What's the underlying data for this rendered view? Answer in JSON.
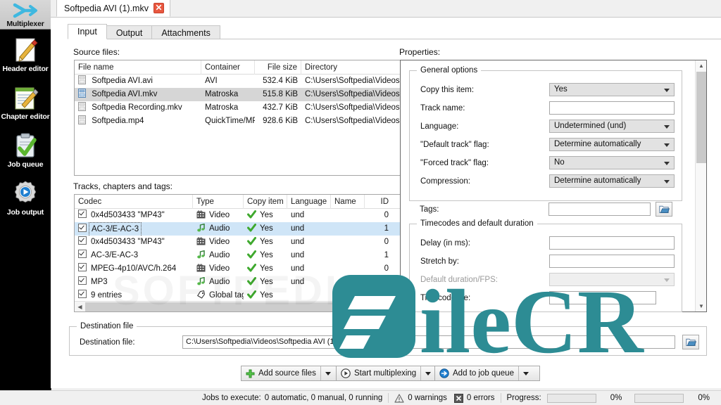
{
  "sidebar": {
    "items": [
      {
        "label": "Multiplexer",
        "icon": "multiplexer-icon",
        "active": true
      },
      {
        "label": "Header editor",
        "icon": "header-editor-icon",
        "active": false
      },
      {
        "label": "Chapter editor",
        "icon": "chapter-editor-icon",
        "active": false
      },
      {
        "label": "Job queue",
        "icon": "job-queue-icon",
        "active": false
      },
      {
        "label": "Job output",
        "icon": "job-output-icon",
        "active": false
      }
    ]
  },
  "document_tab": {
    "title": "Softpedia AVI (1).mkv",
    "close_label": "×"
  },
  "tabs": [
    {
      "label": "Input",
      "active": true
    },
    {
      "label": "Output",
      "active": false
    },
    {
      "label": "Attachments",
      "active": false
    }
  ],
  "source_files": {
    "label": "Source files:",
    "columns": [
      "File name",
      "Container",
      "File size",
      "Directory"
    ],
    "rows": [
      {
        "name": "Softpedia AVI.avi",
        "container": "AVI",
        "size": "532.4 KiB",
        "dir": "C:\\Users\\Softpedia\\Videos",
        "selected": false
      },
      {
        "name": "Softpedia AVI.mkv",
        "container": "Matroska",
        "size": "515.8 KiB",
        "dir": "C:\\Users\\Softpedia\\Videos",
        "selected": true
      },
      {
        "name": "Softpedia Recording.mkv",
        "container": "Matroska",
        "size": "432.7 KiB",
        "dir": "C:\\Users\\Softpedia\\Videos",
        "selected": false
      },
      {
        "name": "Softpedia.mp4",
        "container": "QuickTime/MP4",
        "size": "928.6 KiB",
        "dir": "C:\\Users\\Softpedia\\Videos",
        "selected": false
      }
    ]
  },
  "tracks": {
    "label": "Tracks, chapters and tags:",
    "columns": [
      "Codec",
      "Type",
      "Copy item",
      "Language",
      "Name",
      "ID"
    ],
    "rows": [
      {
        "codec": "0x4d503433 \"MP43\"",
        "type": "Video",
        "type_icon": "video-icon",
        "copy": "Yes",
        "language": "und",
        "name": "",
        "id": "0",
        "selected": false,
        "focused": false
      },
      {
        "codec": "AC-3/E-AC-3",
        "type": "Audio",
        "type_icon": "audio-icon",
        "copy": "Yes",
        "language": "und",
        "name": "",
        "id": "1",
        "selected": true,
        "focused": true
      },
      {
        "codec": "0x4d503433 \"MP43\"",
        "type": "Video",
        "type_icon": "video-icon",
        "copy": "Yes",
        "language": "und",
        "name": "",
        "id": "0",
        "selected": false,
        "focused": false
      },
      {
        "codec": "AC-3/E-AC-3",
        "type": "Audio",
        "type_icon": "audio-icon",
        "copy": "Yes",
        "language": "und",
        "name": "",
        "id": "1",
        "selected": false,
        "focused": false
      },
      {
        "codec": "MPEG-4p10/AVC/h.264",
        "type": "Video",
        "type_icon": "video-icon",
        "copy": "Yes",
        "language": "und",
        "name": "",
        "id": "0",
        "selected": false,
        "focused": false
      },
      {
        "codec": "MP3",
        "type": "Audio",
        "type_icon": "audio-icon",
        "copy": "Yes",
        "language": "und",
        "name": "",
        "id": "",
        "selected": false,
        "focused": false
      },
      {
        "codec": "9 entries",
        "type": "Global tags",
        "type_icon": "tag-icon",
        "copy": "Yes",
        "language": "",
        "name": "",
        "id": "",
        "selected": false,
        "focused": false
      }
    ]
  },
  "properties": {
    "label": "Properties:",
    "general": {
      "title": "General options",
      "fields": [
        {
          "label": "Copy this item:",
          "kind": "combo",
          "value": "Yes"
        },
        {
          "label": "Track name:",
          "kind": "text",
          "value": ""
        },
        {
          "label": "Language:",
          "kind": "combo",
          "value": "Undetermined (und)"
        },
        {
          "label": "\"Default track\" flag:",
          "kind": "combo",
          "value": "Determine automatically"
        },
        {
          "label": "\"Forced track\" flag:",
          "kind": "combo",
          "value": "No"
        },
        {
          "label": "Compression:",
          "kind": "combo",
          "value": "Determine automatically"
        },
        {
          "label": "Tags:",
          "kind": "text-browse",
          "value": ""
        }
      ]
    },
    "timecodes": {
      "title": "Timecodes and default duration",
      "fields": [
        {
          "label": "Delay (in ms):",
          "kind": "text",
          "value": ""
        },
        {
          "label": "Stretch by:",
          "kind": "text",
          "value": ""
        },
        {
          "label": "Default duration/FPS:",
          "kind": "combo-disabled",
          "value": ""
        },
        {
          "label": "Timecode file:",
          "kind": "text-browse",
          "value": ""
        }
      ]
    }
  },
  "destination": {
    "group_title": "Destination file",
    "label": "Destination file:",
    "value": "C:\\Users\\Softpedia\\Videos\\Softpedia AVI (1).mkv",
    "browse_icon": "folder-open-icon"
  },
  "action_buttons": [
    {
      "label": "Add source files",
      "icon": "plus-icon",
      "has_dropdown": true
    },
    {
      "label": "Start multiplexing",
      "icon": "play-icon",
      "has_dropdown": true
    },
    {
      "label": "Add to job queue",
      "icon": "arrow-circle-icon",
      "has_dropdown": true
    }
  ],
  "statusbar": {
    "jobs_label": "Jobs to execute:",
    "jobs_value": "0 automatic, 0 manual, 0 running",
    "warnings": "0 warnings",
    "warnings_icon": "warning-icon",
    "errors": "0 errors",
    "errors_icon": "error-icon",
    "progress_label": "Progress:",
    "progress1": "0%",
    "progress2": "0%"
  },
  "watermark": {
    "text_1": "File",
    "text_2": "CR",
    "brand": "FileCR",
    "color": "#2d8c94",
    "softpedia": "SOFTPEDIA"
  },
  "colors": {
    "selection_blue": "#cfe5f7",
    "selection_grey": "#d6d6d6",
    "accent_green": "#4cae4c",
    "sidebar_bg": "#000000",
    "window_bg": "#f0f0f0"
  }
}
